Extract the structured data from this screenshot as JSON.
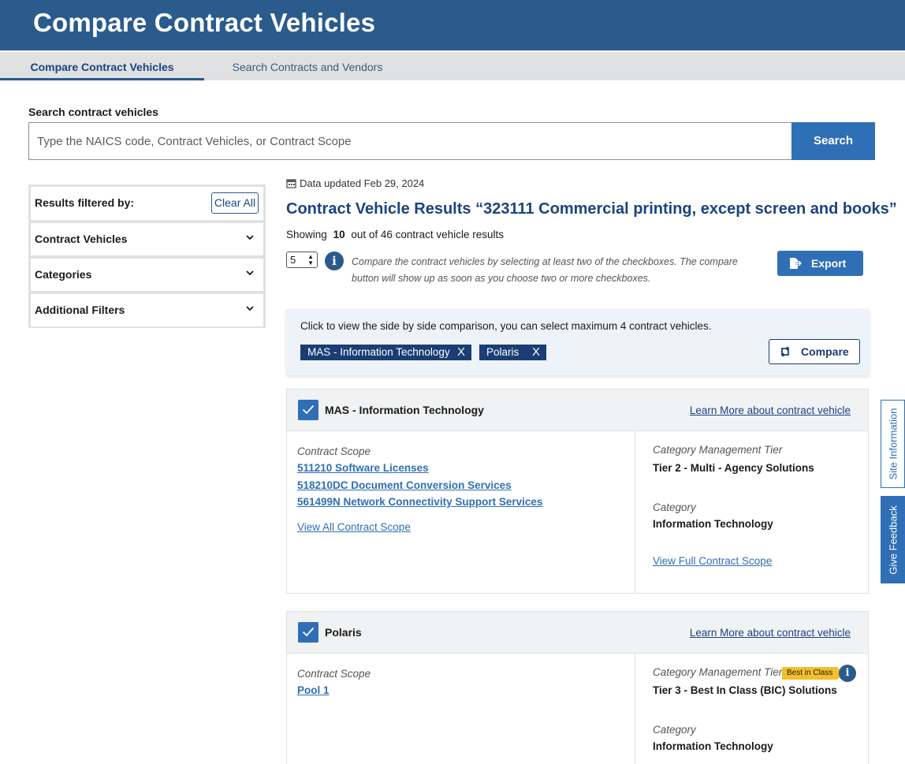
{
  "header": {
    "title": "Compare Contract Vehicles"
  },
  "tabs": [
    {
      "label": "Compare Contract Vehicles",
      "active": true
    },
    {
      "label": "Search Contracts and Vendors",
      "active": false
    }
  ],
  "search": {
    "label": "Search contract vehicles",
    "placeholder": "Type the NAICS code, Contract Vehicles, or Contract Scope",
    "button_label": "Search"
  },
  "filters": {
    "heading": "Results filtered by:",
    "clear_label": "Clear All",
    "items": [
      {
        "label": "Contract Vehicles"
      },
      {
        "label": "Categories"
      },
      {
        "label": "Additional Filters"
      }
    ]
  },
  "results": {
    "updated": "Data updated Feb 29, 2024",
    "title": "Contract Vehicle Results “323111 Commercial printing, except screen and books”",
    "showing_prefix": "Showing",
    "showing_count": "10",
    "showing_suffix": "out of 46 contract vehicle results",
    "per_page": "5",
    "hint": "Compare the contract vehicles by selecting at least two of the checkboxes. The compare button will show up as soon as you  choose two or more checkboxes.",
    "export_label": "Export"
  },
  "compare": {
    "text": "Click to view the side by side comparison, you can select maximum 4 contract vehicles.",
    "chips": [
      "MAS - Information Technology",
      "Polaris"
    ],
    "chip_remove": "X",
    "button_label": "Compare"
  },
  "cards": [
    {
      "name": "MAS - Information Technology",
      "learn_more": "Learn More about contract vehicle",
      "scope_label": "Contract Scope",
      "scope_links": [
        "511210 Software Licenses",
        "518210DC Document Conversion Services",
        "561499N Network Connectivity Support Services"
      ],
      "view_all": "View All Contract Scope",
      "tier_label": "Category Management Tier",
      "tier_value": "Tier 2 - Multi - Agency Solutions",
      "category_label": "Category",
      "category_value": "Information Technology",
      "view_full": "View Full Contract Scope"
    },
    {
      "name": "Polaris",
      "learn_more": "Learn More about contract vehicle",
      "scope_label": "Contract Scope",
      "scope_links": [
        "Pool 1"
      ],
      "tier_label": "Category Management Tier",
      "tier_badge": "Best in Class",
      "tier_value": "Tier 3 - Best In Class (BIC) Solutions",
      "category_label": "Category",
      "category_value": "Information Technology"
    }
  ],
  "side_tabs": {
    "site_info": "Site Information",
    "feedback": "Give Feedback"
  },
  "colors": {
    "header": "#2a5b8c",
    "primary": "#2f6fb6",
    "dark_navy": "#1a3d73",
    "badge": "#f3c02b"
  }
}
